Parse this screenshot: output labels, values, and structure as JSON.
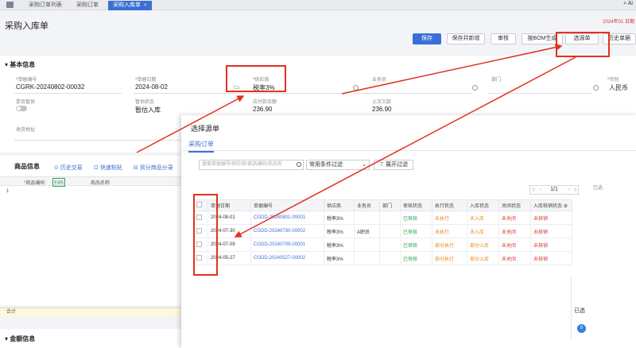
{
  "tabs": [
    {
      "label": "采购订单列表"
    },
    {
      "label": "采购订单"
    },
    {
      "label": "采购入库单",
      "close": "×"
    }
  ],
  "topright": {
    "user": "Ai",
    "date": "2024年01 日期"
  },
  "page": {
    "title": "采购入库单"
  },
  "toolbar": {
    "save": "保存",
    "save_new": "保存并新增",
    "approve": "审核",
    "bom": "按BOM生成",
    "select_source": "选源单",
    "history": "历史单据"
  },
  "basic": {
    "section": "基本信息",
    "doc_no_label": "单据编号",
    "doc_no": "CGRK-20240802-00032",
    "date_label": "单据日期",
    "date": "2024-08-02",
    "supplier_label": "供应商",
    "supplier": "税率3%",
    "salesman_label": "业务员",
    "dept_label": "部门",
    "currency_label": "币别",
    "currency": "人民币",
    "warning_label": "是否暂估",
    "temp_status_label": "暂估状态",
    "temp_status": "暂估入库",
    "payable_label": "应付款余额",
    "payable": "236.90",
    "last_label": "上次欠款",
    "last": "236.90",
    "address_label": "收货地址"
  },
  "goods": {
    "section": "商品信息",
    "history_trade": "历史交易",
    "quick_paste": "快速粘贴",
    "split": "拆分商品分录",
    "col_code": "商品编码",
    "scan": "扫码",
    "col_name": "商品名称",
    "row_no": "1",
    "total": "合计"
  },
  "amount": {
    "section": "金额信息"
  },
  "modal": {
    "title": "选择源单",
    "tab": "采购订单",
    "search_placeholder": "搜索单据编号/供应商/商品编码/商品名",
    "filter_select": "常用条件过滤",
    "expand_filter": "展开过滤",
    "page": "1/1",
    "selected_label": "已选",
    "selected_side": "已选",
    "selected_count": "0",
    "columns": [
      "单据日期",
      "单据编号",
      "供应商",
      "业务员",
      "部门",
      "审核状态",
      "执行状态",
      "入库状态",
      "关闭状态",
      "入库核销状态"
    ],
    "rows": [
      {
        "date": "2024-08-01",
        "no": "CGDD-20240801-00001",
        "supplier": "税率3%",
        "salesman": "",
        "dept": "",
        "audit": "已审核",
        "exec": "未执行",
        "stock": "未入库",
        "close": "未关闭",
        "verify": "未核销"
      },
      {
        "date": "2024-07-30",
        "no": "CGDD-20240730-00002",
        "supplier": "税率3%",
        "salesman": "A职员",
        "dept": "",
        "audit": "已审核",
        "exec": "未执行",
        "stock": "未入库",
        "close": "未关闭",
        "verify": "未核销"
      },
      {
        "date": "2024-07-09",
        "no": "CGDD-20240709-00001",
        "supplier": "税率3%",
        "salesman": "",
        "dept": "",
        "audit": "已审核",
        "exec": "部分执行",
        "stock": "部分入库",
        "close": "未关闭",
        "verify": "未核销"
      },
      {
        "date": "2024-05-27",
        "no": "CGDD-20240527-00002",
        "supplier": "税率3%",
        "salesman": "",
        "dept": "",
        "audit": "已审核",
        "exec": "部分执行",
        "stock": "部分入库",
        "close": "未关闭",
        "verify": "未核销"
      }
    ]
  },
  "colors": {
    "accent": "#3b6fd6",
    "annotation": "#e2311f",
    "ok": "#2ba45a",
    "warn": "#e58a1f",
    "danger": "#d33333"
  }
}
